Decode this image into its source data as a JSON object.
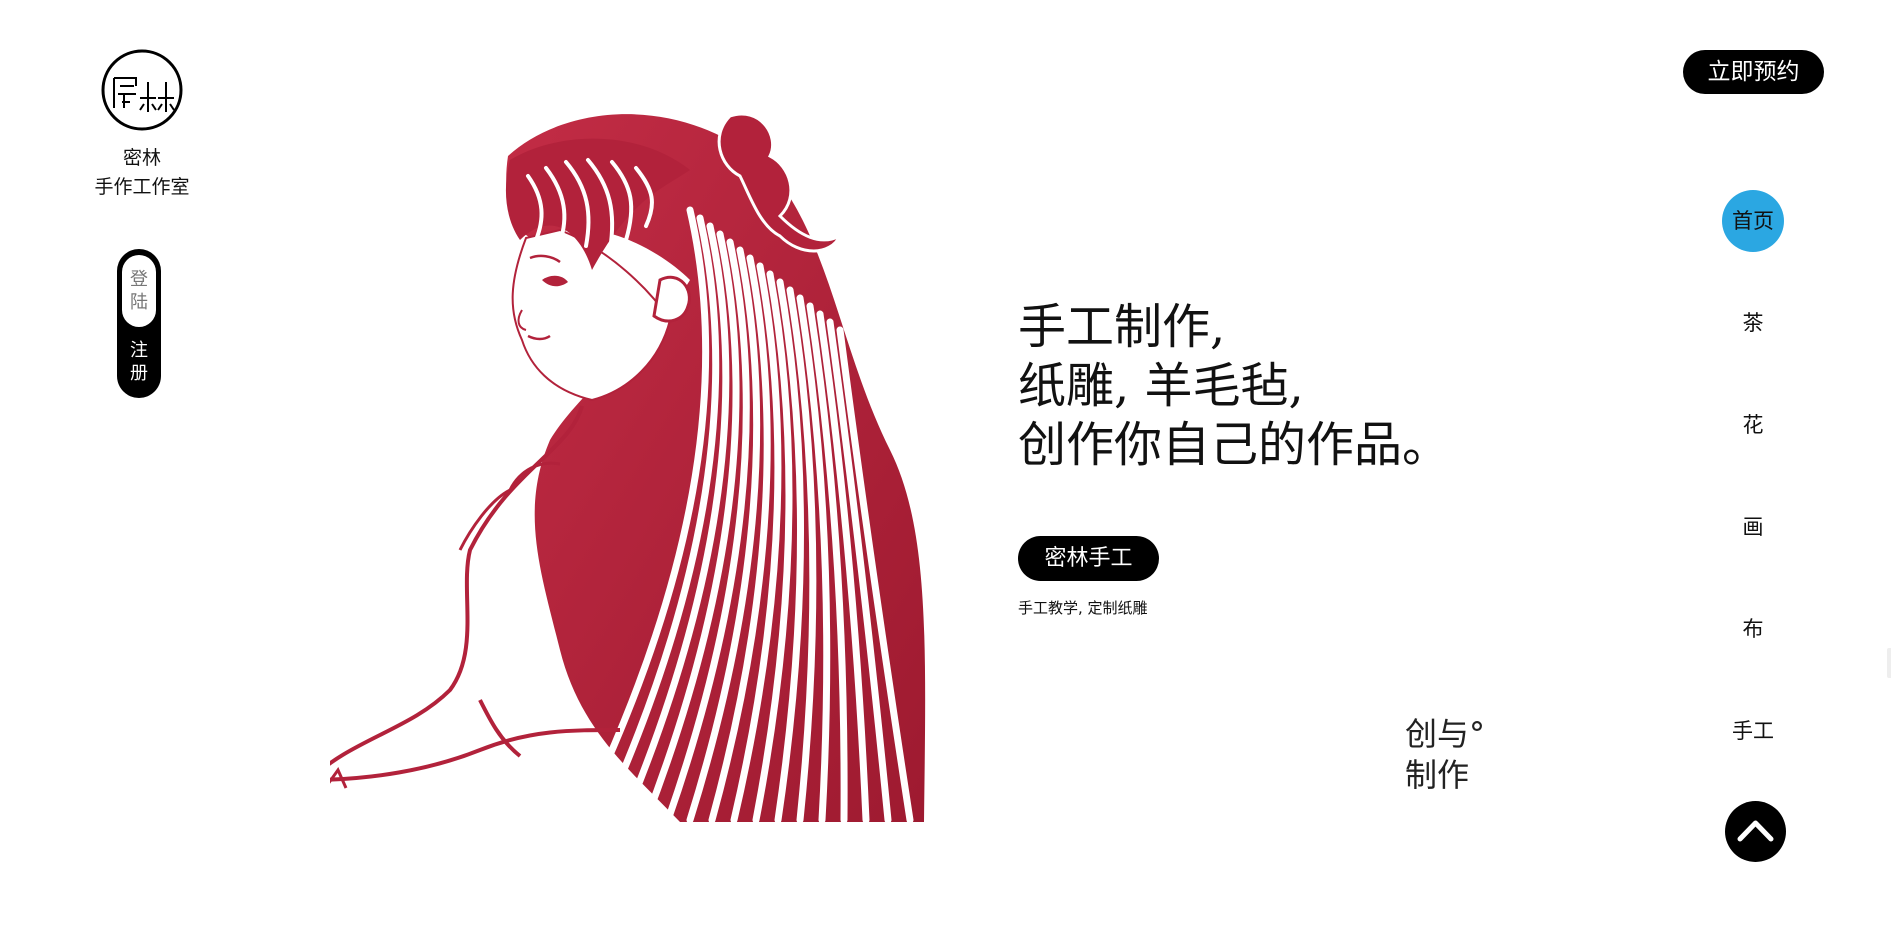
{
  "brand": {
    "logo_icon": "milin-seal-logo-icon",
    "name_line1": "密林",
    "name_line2": "手作工作室"
  },
  "auth": {
    "login_label_chars": [
      "登",
      "陆"
    ],
    "register_label_chars": [
      "注",
      "册"
    ]
  },
  "hero": {
    "headline_lines": [
      "手工制作,",
      "纸雕, 羊毛毡,",
      "创作你自己的作品。"
    ],
    "cta_label": "密林手工",
    "subtitle": "手工教学, 定制纸雕",
    "tagline_lines": [
      "创与°",
      "制作"
    ],
    "artwork_icon": "paper-cut-girl-illustration",
    "artwork_color": "#b2223b"
  },
  "header": {
    "reserve_label": "立即预约"
  },
  "nav": {
    "active_color": "#2ba7e2",
    "items": [
      {
        "label": "首页",
        "active": true
      },
      {
        "label": "茶",
        "active": false
      },
      {
        "label": "花",
        "active": false
      },
      {
        "label": "画",
        "active": false
      },
      {
        "label": "布",
        "active": false
      },
      {
        "label": "手工",
        "active": false
      }
    ]
  },
  "scroll_top": {
    "icon": "chevron-up-icon"
  }
}
